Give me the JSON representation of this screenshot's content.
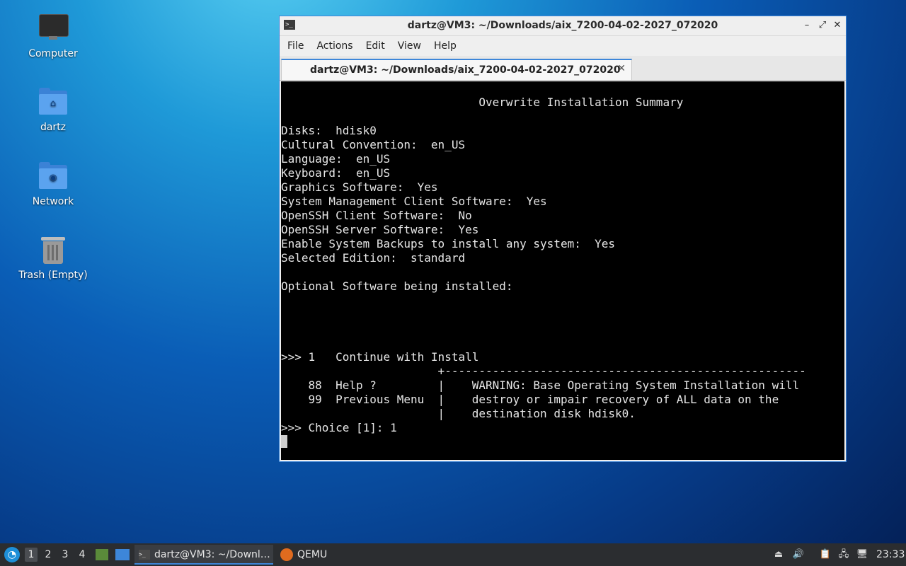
{
  "desktop": {
    "icons": [
      {
        "label": "Computer",
        "icon": "computer-icon"
      },
      {
        "label": "dartz",
        "icon": "home-folder-icon"
      },
      {
        "label": "Network",
        "icon": "network-folder-icon"
      },
      {
        "label": "Trash (Empty)",
        "icon": "trash-icon"
      }
    ]
  },
  "window": {
    "title": "dartz@VM3: ~/Downloads/aix_7200-04-02-2027_072020",
    "menu": [
      "File",
      "Actions",
      "Edit",
      "View",
      "Help"
    ],
    "tab_title": "dartz@VM3: ~/Downloads/aix_7200-04-02-2027_072020",
    "controls": {
      "minimize": "–",
      "maximize": "⤢",
      "close": "✕"
    }
  },
  "terminal": {
    "lines": [
      "                             Overwrite Installation Summary",
      "",
      "Disks:  hdisk0",
      "Cultural Convention:  en_US",
      "Language:  en_US",
      "Keyboard:  en_US",
      "Graphics Software:  Yes",
      "System Management Client Software:  Yes",
      "OpenSSH Client Software:  No",
      "OpenSSH Server Software:  Yes",
      "Enable System Backups to install any system:  Yes",
      "Selected Edition:  standard",
      "",
      "Optional Software being installed:",
      "",
      "",
      "",
      "",
      ">>> 1   Continue with Install",
      "                       +-----------------------------------------------------",
      "    88  Help ?         |    WARNING: Base Operating System Installation will",
      "    99  Previous Menu  |    destroy or impair recovery of ALL data on the",
      "                       |    destination disk hdisk0.",
      ">>> Choice [1]: 1"
    ]
  },
  "taskbar": {
    "workspaces": [
      "1",
      "2",
      "3",
      "4"
    ],
    "tasks": [
      {
        "label": "dartz@VM3: ~/Downl…",
        "icon": "terminal-icon"
      },
      {
        "label": "QEMU",
        "icon": "qemu-icon"
      }
    ],
    "clock": "23:33"
  }
}
